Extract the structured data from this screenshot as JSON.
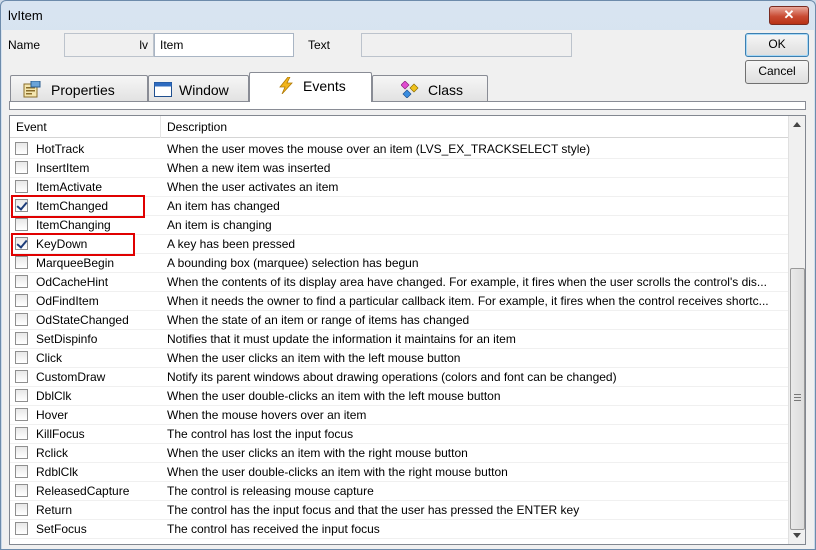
{
  "window": {
    "title": "lvItem",
    "close_label": "✕"
  },
  "form": {
    "name_label": "Name",
    "name_prefix": "lv",
    "name_value": "Item",
    "text_label": "Text",
    "text_value": ""
  },
  "buttons": {
    "ok": "OK",
    "cancel": "Cancel"
  },
  "tabs": [
    {
      "label": "Properties",
      "icon": "properties-icon",
      "active": false
    },
    {
      "label": "Window",
      "icon": "window-icon",
      "active": false
    },
    {
      "label": "Events",
      "icon": "lightning-icon",
      "active": true
    },
    {
      "label": "Class",
      "icon": "class-icon",
      "active": false
    }
  ],
  "list": {
    "columns": [
      "Event",
      "Description"
    ],
    "rows": [
      {
        "event": "HotTrack",
        "description": "When the user moves the mouse over an item (LVS_EX_TRACKSELECT style)",
        "checked": false
      },
      {
        "event": "InsertItem",
        "description": "When a new item was inserted",
        "checked": false
      },
      {
        "event": "ItemActivate",
        "description": "When the user activates an item",
        "checked": false
      },
      {
        "event": "ItemChanged",
        "description": "An item has changed",
        "checked": true,
        "highlighted": true
      },
      {
        "event": "ItemChanging",
        "description": "An item is changing",
        "checked": false
      },
      {
        "event": "KeyDown",
        "description": "A key has been pressed",
        "checked": true,
        "highlighted": true
      },
      {
        "event": "MarqueeBegin",
        "description": "A bounding box (marquee) selection has begun",
        "checked": false
      },
      {
        "event": "OdCacheHint",
        "description": "When the contents of its display area have changed. For example, it fires when the user scrolls the control's dis...",
        "checked": false
      },
      {
        "event": "OdFindItem",
        "description": "When it needs the owner to find a particular callback item. For example, it fires when the control receives shortc...",
        "checked": false
      },
      {
        "event": "OdStateChanged",
        "description": "When the state of an item or range of items has changed",
        "checked": false
      },
      {
        "event": "SetDispinfo",
        "description": "Notifies that it must update the information it maintains for an item",
        "checked": false
      },
      {
        "event": "Click",
        "description": "When the user clicks an item with the left mouse button",
        "checked": false
      },
      {
        "event": "CustomDraw",
        "description": "Notify its parent windows about drawing operations (colors and font can be changed)",
        "checked": false
      },
      {
        "event": "DblClk",
        "description": "When the user double-clicks an item with the left mouse button",
        "checked": false
      },
      {
        "event": "Hover",
        "description": "When the mouse hovers over an item",
        "checked": false
      },
      {
        "event": "KillFocus",
        "description": "The control has lost the input focus",
        "checked": false
      },
      {
        "event": "Rclick",
        "description": "When the user clicks an item with the right mouse button",
        "checked": false
      },
      {
        "event": "RdblClk",
        "description": "When the user double-clicks an item with the right mouse button",
        "checked": false
      },
      {
        "event": "ReleasedCapture",
        "description": "The control is releasing mouse capture",
        "checked": false
      },
      {
        "event": "Return",
        "description": "The control has the input focus and that the user has pressed the ENTER key",
        "checked": false
      },
      {
        "event": "SetFocus",
        "description": "The control has received the input focus",
        "checked": false
      }
    ]
  },
  "colors": {
    "highlight_border": "#e00000",
    "check_mark": "#1e3d7a"
  }
}
